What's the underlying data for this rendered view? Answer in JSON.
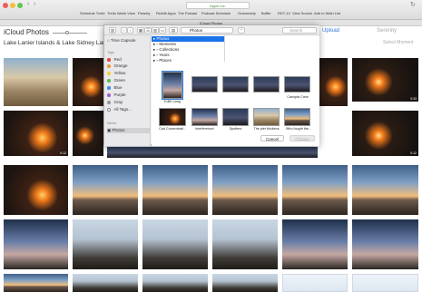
{
  "browser": {
    "address": "Apple Inc.",
    "tab_title": "iCloud Photos",
    "bookmarks": [
      "Schedule Trello",
      "Trello Week View",
      "Parsely",
      "Reddit Apps",
      "The Pulcast",
      "Podcast Schedule",
      "Grammarly",
      "Buffer",
      "RDT-13",
      "View Source",
      "Add to Wish List"
    ]
  },
  "app": {
    "logo_prefix": "iCloud",
    "logo_suffix": "Photos",
    "upload_label": "Upload",
    "user_name": "Serenity",
    "album_title": "Lake Lanier Islands & Lake Sidney Lanier",
    "select_label": "Select Moment"
  },
  "dialog": {
    "location": "Photos",
    "search_placeholder": "Search",
    "sidebar": {
      "time_capsule": "Time Capsule",
      "tags_header": "Tags",
      "tags": [
        {
          "label": "Red",
          "color": "#e2473c"
        },
        {
          "label": "Orange",
          "color": "#f09a38"
        },
        {
          "label": "Yellow",
          "color": "#f5cf3c"
        },
        {
          "label": "Green",
          "color": "#58c04a"
        },
        {
          "label": "Blue",
          "color": "#3a8de8"
        },
        {
          "label": "Purple",
          "color": "#a35ed0"
        },
        {
          "label": "Gray",
          "color": "#9a9a9a"
        }
      ],
      "all_tags": "All Tags...",
      "media_header": "Media",
      "photos": "Photos"
    },
    "columns": [
      "Photos",
      "Moments",
      "Collections",
      "Years",
      "Places"
    ],
    "row1_caption_first": "Edith Lang",
    "row1_caption_last": "Canopta Crew",
    "captions": [
      "Cad Concentrati...",
      "Interference!",
      "Spotters",
      "The pier thickens",
      "Who fought the..."
    ],
    "cancel_label": "Cancel",
    "choose_label": "Choose"
  },
  "grid": {
    "durations": [
      "0:33",
      "0:12",
      "0:12"
    ]
  }
}
